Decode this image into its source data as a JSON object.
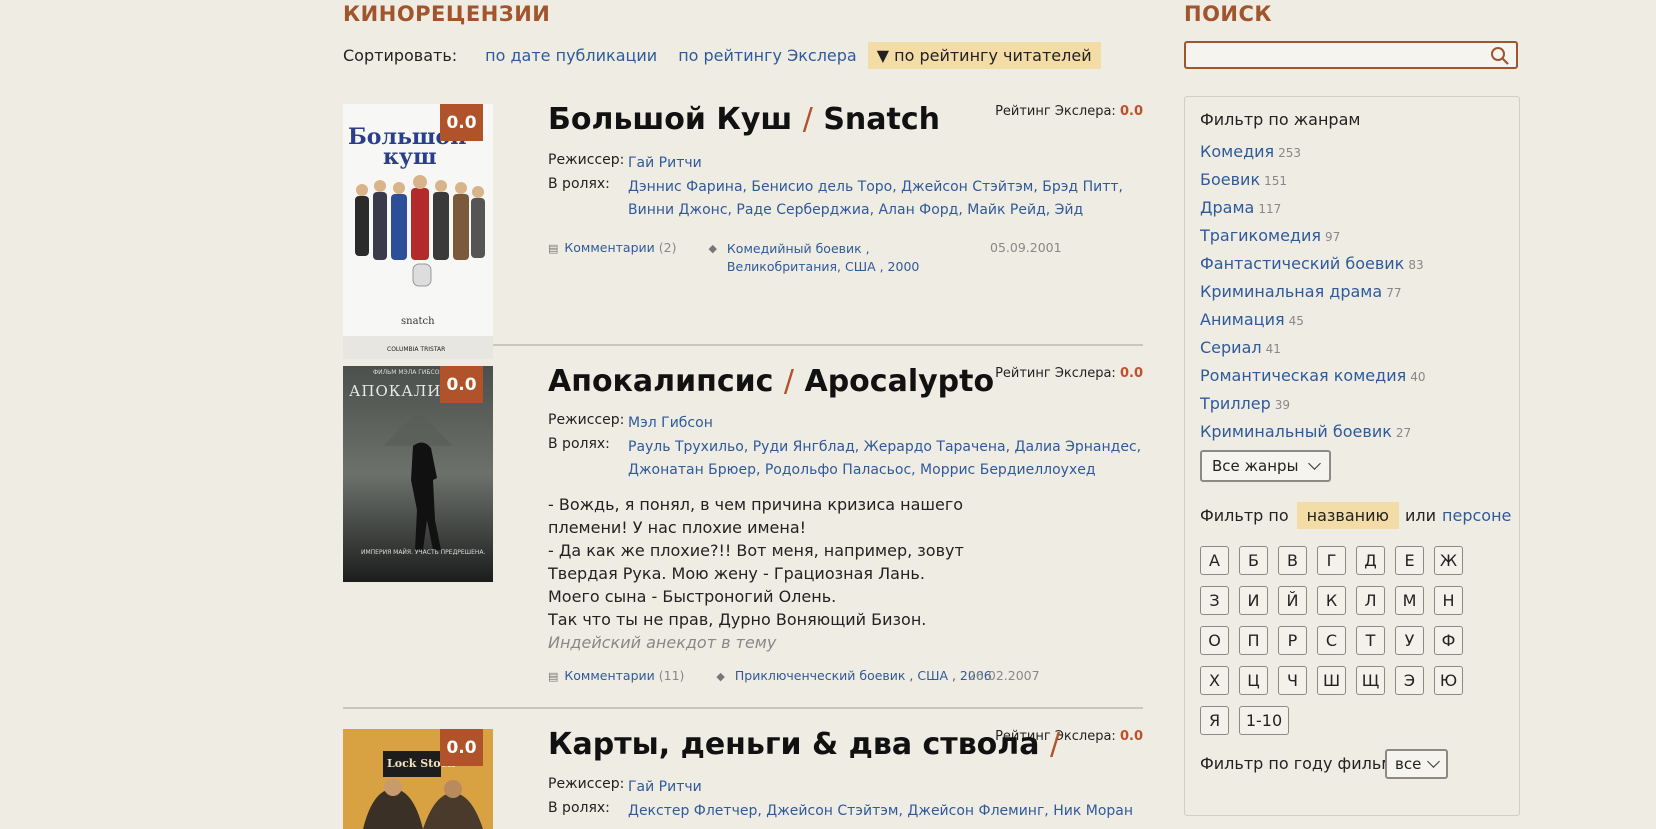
{
  "main": {
    "title": "КИНОРЕЦЕНЗИИ",
    "sort_label": "Сортировать:",
    "sort_options": [
      "по дате публикации",
      "по рейтингу Экслера",
      "▼ по рейтингу читателей"
    ]
  },
  "films": [
    {
      "badge": "0.0",
      "rating_label": "Рейтинг Экслера:",
      "rating_value": "0.0",
      "title_ru": "Большой Куш",
      "slash": "/",
      "title_en": "Snatch",
      "director_label": "Режиссер:",
      "director": "Гай Ритчи",
      "cast_label": "В ролях:",
      "cast": "Дэннис Фарина, Бенисио дель Торо, Джейсон Стэйтэм, Брэд Питт, Винни Джонс, Раде Серберджиа, Алан Форд, Майк Рейд, Эйд",
      "comments_label": "Комментарии",
      "comments_count": "(2)",
      "tags": "Комедийный боевик , Великобритания, США , 2000",
      "date": "05.09.2001",
      "poster_title": "Большой куш",
      "poster_sub": "Snatch",
      "poster_studio": "COLUMBIA TRISTAR"
    },
    {
      "badge": "0.0",
      "rating_label": "Рейтинг Экслера:",
      "rating_value": "0.0",
      "title_ru": "Апокалипсис",
      "slash": "/",
      "title_en": "Apocalypto",
      "director_label": "Режиссер:",
      "director": "Мэл Гибсон",
      "cast_label": "В ролях:",
      "cast": "Рауль Трухильо, Руди Янгблад, Жерардо Тарачена, Далиа Эрнандес, Джонатан Брюер, Родольфо Паласьос, Моррис Бердиеллоухед",
      "quote_lines": [
        "- Вождь, я понял, в чем причина кризиса нашего",
        "племени! У нас плохие имена!",
        "- Да как же плохие?!! Вот меня, например, зовут",
        "Твердая Рука. Мою жену - Грациозная Лань.",
        "Моего сына - Быстроногий Олень.",
        "Так что ты не прав, Дурно Воняющий Бизон."
      ],
      "quote_source": "Индейский анекдот в тему",
      "comments_label": "Комментарии",
      "comments_count": "(11)",
      "tags": "Приключенческий боевик , США , 2006",
      "date": "26.02.2007",
      "poster_title": "АПОКАЛИПСИС",
      "poster_top": "ФИЛЬМ МЭЛА ГИБСОНА",
      "poster_tagline": "ИМПЕРИЯ МАЙЯ. УЧАСТЬ ПРЕДРЕШЕНА."
    },
    {
      "badge": "0.0",
      "rating_label": "Рейтинг Экслера:",
      "rating_value": "0.0",
      "title_ru": "Карты, деньги & два ствола",
      "slash": "/",
      "director_label": "Режиссер:",
      "director": "Гай Ритчи",
      "cast_label": "В ролях:",
      "cast": "Декстер Флетчер, Джейсон Стэйтэм, Джейсон Флеминг, Ник Моран",
      "poster_title": "Lock Stock & Two Smoking Barrels"
    }
  ],
  "sidebar": {
    "search_title": "ПОИСК",
    "search_value": "",
    "genre_filter_title": "Фильтр по жанрам",
    "genres": [
      {
        "name": "Комедия",
        "count": "253"
      },
      {
        "name": "Боевик",
        "count": "151"
      },
      {
        "name": "Драма",
        "count": "117"
      },
      {
        "name": "Трагикомедия",
        "count": "97"
      },
      {
        "name": "Фантастический боевик",
        "count": "83"
      },
      {
        "name": "Криминальная драма",
        "count": "77"
      },
      {
        "name": "Анимация",
        "count": "45"
      },
      {
        "name": "Сериал",
        "count": "41"
      },
      {
        "name": "Романтическая комедия",
        "count": "40"
      },
      {
        "name": "Триллер",
        "count": "39"
      },
      {
        "name": "Криминальный боевик",
        "count": "27"
      }
    ],
    "all_genres": "Все жанры",
    "filter_by": "Фильтр по",
    "by_name": "названию",
    "or": "или",
    "by_person": "персоне",
    "letters": [
      "А",
      "Б",
      "В",
      "Г",
      "Д",
      "Е",
      "Ж",
      "З",
      "И",
      "Й",
      "К",
      "Л",
      "М",
      "Н",
      "О",
      "П",
      "Р",
      "С",
      "Т",
      "У",
      "Ф",
      "Х",
      "Ц",
      "Ч",
      "Ш",
      "Щ",
      "Э",
      "Ю",
      "Я",
      "1-10"
    ],
    "year_filter_label": "Фильтр по году фильма",
    "year_value": "все"
  },
  "colors": {
    "accent": "#a0552c",
    "link": "#2f5a9a",
    "badge": "#b0532b",
    "highlight": "#f3dca6",
    "background": "#efece3"
  }
}
